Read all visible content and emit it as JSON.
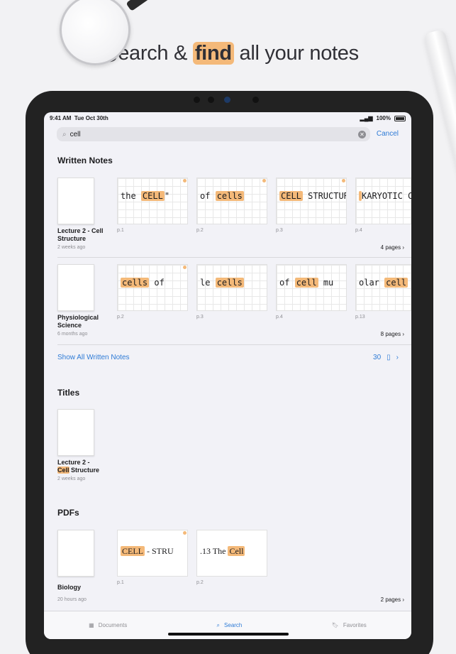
{
  "headline": {
    "big_letter": "S",
    "part1": "earch & ",
    "highlight": "find",
    "part2": " all your notes"
  },
  "status": {
    "time": "9:41 AM",
    "date": "Tue Oct 30th",
    "battery": "100%"
  },
  "search": {
    "icon": "search-icon",
    "value": "cell",
    "cancel": "Cancel"
  },
  "written_notes": {
    "title": "Written Notes",
    "docs": [
      {
        "name": "Lecture 2 - Cell Structure",
        "date": "2 weeks ago",
        "pages_label": "4 pages",
        "pages": [
          {
            "label": "p.1",
            "pre": "the ",
            "hit": "CELL",
            "post": "\""
          },
          {
            "label": "p.2",
            "pre": "of ",
            "hit": "cells",
            "post": ""
          },
          {
            "label": "p.3",
            "pre": "",
            "hit": "CELL",
            "post": " STRUCTURE"
          },
          {
            "label": "p.4",
            "pre": "",
            "hit": "",
            "post": "KARYOTIC CEL"
          }
        ]
      },
      {
        "name": "Physiological Science",
        "date": "6 months ago",
        "pages_label": "8 pages",
        "pages": [
          {
            "label": "p.2",
            "pre": "",
            "hit": "cells",
            "post": " of"
          },
          {
            "label": "p.3",
            "pre": "le ",
            "hit": "cells",
            "post": ""
          },
          {
            "label": "p.4",
            "pre": " of ",
            "hit": "cell",
            "post": " mu"
          },
          {
            "label": "p.13",
            "pre": "olar ",
            "hit": "cell",
            "post": ""
          }
        ]
      }
    ],
    "show_all": "Show All Written Notes",
    "count": "30"
  },
  "titles": {
    "title": "Titles",
    "doc": {
      "name_hit": "Lecture 2 -",
      "name_hl": "Cell",
      "name_rest": " Structure",
      "date": "2 weeks ago"
    }
  },
  "pdfs": {
    "title": "PDFs",
    "doc": {
      "name": "Biology",
      "date": "20 hours ago",
      "pages_label": "2 pages"
    },
    "pages": [
      {
        "label": "p.1",
        "pre": "",
        "hit": "CELL",
        "post": " - STRU"
      },
      {
        "label": "p.2",
        "pre": ".13 The ",
        "hit": "Cell",
        "post": ""
      }
    ]
  },
  "tabs": [
    {
      "label": "Documents",
      "icon": "grid-icon"
    },
    {
      "label": "Search",
      "icon": "search-icon"
    },
    {
      "label": "Favorites",
      "icon": "bookmark-icon"
    }
  ]
}
